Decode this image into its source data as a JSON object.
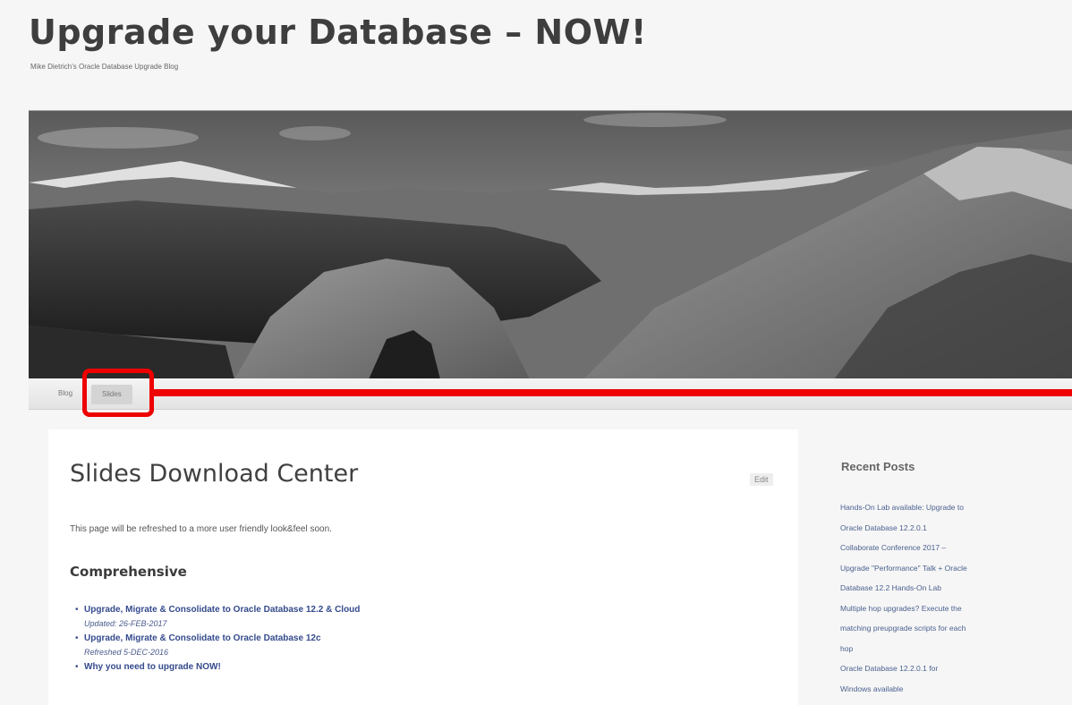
{
  "site": {
    "title": "Upgrade your Database – NOW!",
    "description": "Mike Dietrich's Oracle Database Upgrade Blog"
  },
  "nav": {
    "items": [
      {
        "label": "Blog"
      },
      {
        "label": "Slides"
      }
    ],
    "active_item": "Slides"
  },
  "page": {
    "title": "Slides Download Center",
    "edit_label": "Edit",
    "intro": "This page will be refreshed to a more user friendly look&feel soon.",
    "section_title": "Comprehensive",
    "links": [
      {
        "title": "Upgrade, Migrate & Consolidate to Oracle Database 12.2 & Cloud",
        "sub": "Updated: 26-FEB-2017"
      },
      {
        "title": "Upgrade, Migrate & Consolidate to Oracle Database 12c",
        "sub": "Refreshed 5-DEC-2016"
      },
      {
        "title": "Why you need to upgrade NOW!",
        "sub": ""
      }
    ]
  },
  "sidebar": {
    "title": "Recent Posts",
    "posts": [
      {
        "line": "Hands-On Lab available: Upgrade to"
      },
      {
        "line": "Oracle Database 12.2.0.1"
      },
      {
        "line": "Collaborate Conference 2017 –"
      },
      {
        "line": "Upgrade \"Performance\" Talk + Oracle"
      },
      {
        "line": "Database 12.2 Hands-On Lab"
      },
      {
        "line": "Multiple hop upgrades? Execute the"
      },
      {
        "line": "matching preupgrade scripts for each"
      },
      {
        "line": "hop"
      },
      {
        "line": "Oracle Database 12.2.0.1 for"
      },
      {
        "line": "Windows available"
      }
    ]
  },
  "colors": {
    "highlight": "#ee0000",
    "link": "#344a8c"
  }
}
